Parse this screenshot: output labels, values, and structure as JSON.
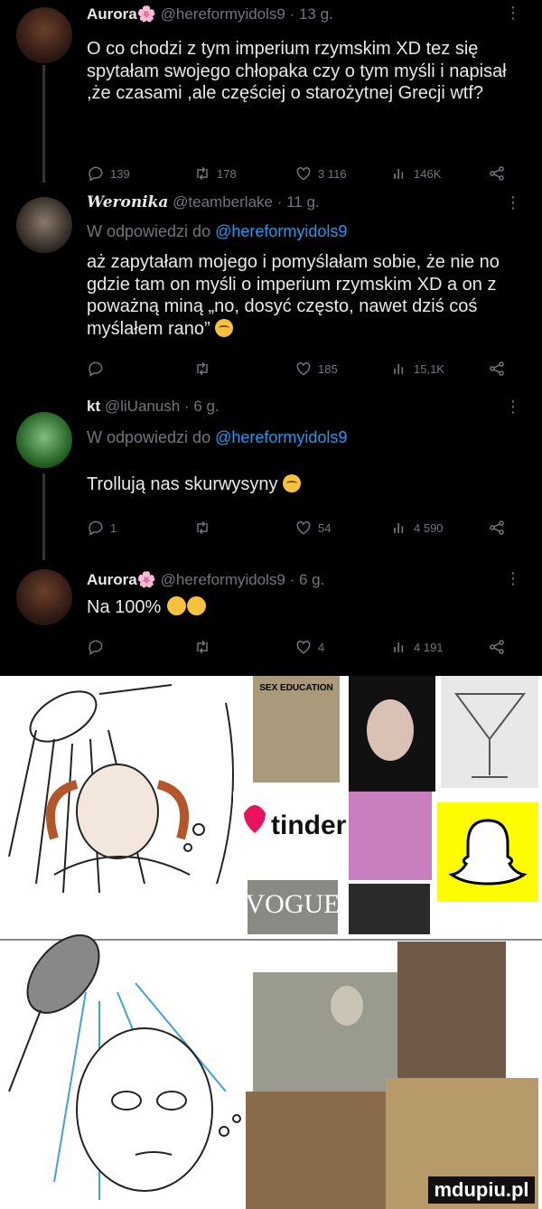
{
  "tweets": [
    {
      "display_name": "Aurora🌸",
      "handle_meta": "@hereformyidols9 · 13 g.",
      "more": "⋮",
      "text": "O co chodzi z tym imperium rzymskim XD tez się spytałam swojego chłopaka czy o tym myśli i napisał ,że czasami ,ale częściej o starożytnej Grecji wtf?",
      "replies": "139",
      "retweets": "178",
      "likes": "3 116",
      "views": "146K"
    },
    {
      "display_name": "Weronika",
      "handle_meta": "@teamberlake · 11 g.",
      "more": "⋮",
      "reply_prefix": "W odpowiedzi do",
      "reply_handle": "@hereformyidols9",
      "text": "aż zapytałam mojego i pomyślałam sobie, że nie no gdzie tam on myśli o imperium rzymskim XD a on z poważną miną „no, dosyć często, nawet dziś coś myślałem rano”",
      "replies": "",
      "retweets": "",
      "likes": "185",
      "views": "15,1K"
    },
    {
      "display_name": "kt",
      "handle_meta": "@liUanush · 6 g.",
      "more": "⋮",
      "reply_prefix": "W odpowiedzi do",
      "reply_handle": "@hereformyidols9",
      "text": "Trollują nas skurwysyny",
      "replies": "1",
      "retweets": "",
      "likes": "54",
      "views": "4 590"
    },
    {
      "display_name": "Aurora🌸",
      "handle_meta": "@hereformyidols9 · 6 g.",
      "more": "⋮",
      "text": "Na 100%",
      "replies": "",
      "retweets": "",
      "likes": "4",
      "views": "4 191"
    }
  ],
  "meme": {
    "collage_top": [
      "SEX EDUCATION",
      "tinder",
      "VOGUE"
    ],
    "watermark": "mdupiu.pl"
  },
  "colors": {
    "background": "#000000",
    "text": "#e7e9ea",
    "muted": "#71767b",
    "link": "#1d9bf0",
    "meme_bg": "#ffffff"
  },
  "icons": [
    "reply-icon",
    "retweet-icon",
    "like-icon",
    "views-icon",
    "share-icon"
  ]
}
